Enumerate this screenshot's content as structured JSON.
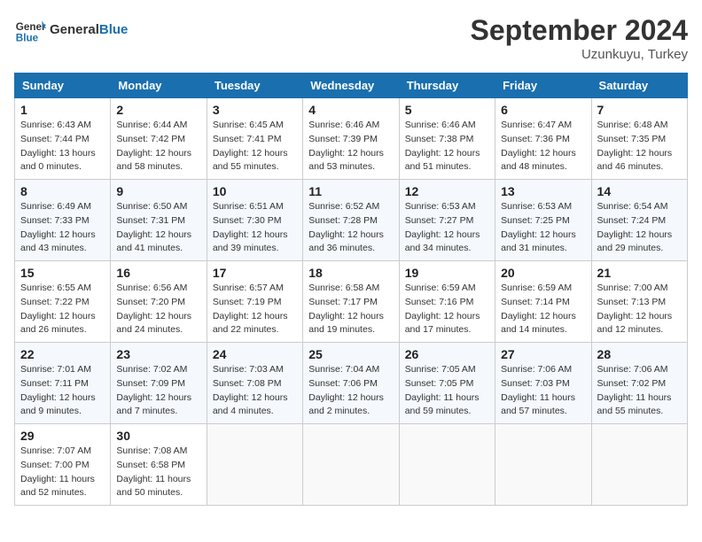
{
  "header": {
    "logo_general": "General",
    "logo_blue": "Blue",
    "month_title": "September 2024",
    "location": "Uzunkuyu, Turkey"
  },
  "columns": [
    "Sunday",
    "Monday",
    "Tuesday",
    "Wednesday",
    "Thursday",
    "Friday",
    "Saturday"
  ],
  "weeks": [
    [
      {
        "day": "1",
        "sunrise": "6:43 AM",
        "sunset": "7:44 PM",
        "daylight": "Daylight: 13 hours and 0 minutes."
      },
      {
        "day": "2",
        "sunrise": "6:44 AM",
        "sunset": "7:42 PM",
        "daylight": "Daylight: 12 hours and 58 minutes."
      },
      {
        "day": "3",
        "sunrise": "6:45 AM",
        "sunset": "7:41 PM",
        "daylight": "Daylight: 12 hours and 55 minutes."
      },
      {
        "day": "4",
        "sunrise": "6:46 AM",
        "sunset": "7:39 PM",
        "daylight": "Daylight: 12 hours and 53 minutes."
      },
      {
        "day": "5",
        "sunrise": "6:46 AM",
        "sunset": "7:38 PM",
        "daylight": "Daylight: 12 hours and 51 minutes."
      },
      {
        "day": "6",
        "sunrise": "6:47 AM",
        "sunset": "7:36 PM",
        "daylight": "Daylight: 12 hours and 48 minutes."
      },
      {
        "day": "7",
        "sunrise": "6:48 AM",
        "sunset": "7:35 PM",
        "daylight": "Daylight: 12 hours and 46 minutes."
      }
    ],
    [
      {
        "day": "8",
        "sunrise": "6:49 AM",
        "sunset": "7:33 PM",
        "daylight": "Daylight: 12 hours and 43 minutes."
      },
      {
        "day": "9",
        "sunrise": "6:50 AM",
        "sunset": "7:31 PM",
        "daylight": "Daylight: 12 hours and 41 minutes."
      },
      {
        "day": "10",
        "sunrise": "6:51 AM",
        "sunset": "7:30 PM",
        "daylight": "Daylight: 12 hours and 39 minutes."
      },
      {
        "day": "11",
        "sunrise": "6:52 AM",
        "sunset": "7:28 PM",
        "daylight": "Daylight: 12 hours and 36 minutes."
      },
      {
        "day": "12",
        "sunrise": "6:53 AM",
        "sunset": "7:27 PM",
        "daylight": "Daylight: 12 hours and 34 minutes."
      },
      {
        "day": "13",
        "sunrise": "6:53 AM",
        "sunset": "7:25 PM",
        "daylight": "Daylight: 12 hours and 31 minutes."
      },
      {
        "day": "14",
        "sunrise": "6:54 AM",
        "sunset": "7:24 PM",
        "daylight": "Daylight: 12 hours and 29 minutes."
      }
    ],
    [
      {
        "day": "15",
        "sunrise": "6:55 AM",
        "sunset": "7:22 PM",
        "daylight": "Daylight: 12 hours and 26 minutes."
      },
      {
        "day": "16",
        "sunrise": "6:56 AM",
        "sunset": "7:20 PM",
        "daylight": "Daylight: 12 hours and 24 minutes."
      },
      {
        "day": "17",
        "sunrise": "6:57 AM",
        "sunset": "7:19 PM",
        "daylight": "Daylight: 12 hours and 22 minutes."
      },
      {
        "day": "18",
        "sunrise": "6:58 AM",
        "sunset": "7:17 PM",
        "daylight": "Daylight: 12 hours and 19 minutes."
      },
      {
        "day": "19",
        "sunrise": "6:59 AM",
        "sunset": "7:16 PM",
        "daylight": "Daylight: 12 hours and 17 minutes."
      },
      {
        "day": "20",
        "sunrise": "6:59 AM",
        "sunset": "7:14 PM",
        "daylight": "Daylight: 12 hours and 14 minutes."
      },
      {
        "day": "21",
        "sunrise": "7:00 AM",
        "sunset": "7:13 PM",
        "daylight": "Daylight: 12 hours and 12 minutes."
      }
    ],
    [
      {
        "day": "22",
        "sunrise": "7:01 AM",
        "sunset": "7:11 PM",
        "daylight": "Daylight: 12 hours and 9 minutes."
      },
      {
        "day": "23",
        "sunrise": "7:02 AM",
        "sunset": "7:09 PM",
        "daylight": "Daylight: 12 hours and 7 minutes."
      },
      {
        "day": "24",
        "sunrise": "7:03 AM",
        "sunset": "7:08 PM",
        "daylight": "Daylight: 12 hours and 4 minutes."
      },
      {
        "day": "25",
        "sunrise": "7:04 AM",
        "sunset": "7:06 PM",
        "daylight": "Daylight: 12 hours and 2 minutes."
      },
      {
        "day": "26",
        "sunrise": "7:05 AM",
        "sunset": "7:05 PM",
        "daylight": "Daylight: 11 hours and 59 minutes."
      },
      {
        "day": "27",
        "sunrise": "7:06 AM",
        "sunset": "7:03 PM",
        "daylight": "Daylight: 11 hours and 57 minutes."
      },
      {
        "day": "28",
        "sunrise": "7:06 AM",
        "sunset": "7:02 PM",
        "daylight": "Daylight: 11 hours and 55 minutes."
      }
    ],
    [
      {
        "day": "29",
        "sunrise": "7:07 AM",
        "sunset": "7:00 PM",
        "daylight": "Daylight: 11 hours and 52 minutes."
      },
      {
        "day": "30",
        "sunrise": "7:08 AM",
        "sunset": "6:58 PM",
        "daylight": "Daylight: 11 hours and 50 minutes."
      },
      null,
      null,
      null,
      null,
      null
    ]
  ]
}
